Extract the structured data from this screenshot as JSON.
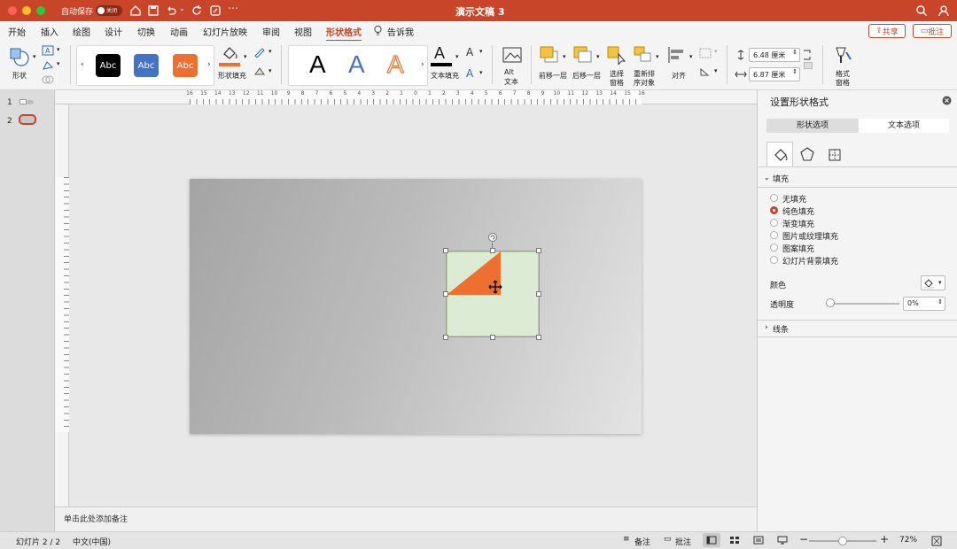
{
  "titlebar": {
    "autosave_label": "自动保存",
    "autosave_state": "关闭",
    "title": "演示文稿 3"
  },
  "menu": [
    "开始",
    "插入",
    "绘图",
    "设计",
    "切换",
    "动画",
    "幻灯片放映",
    "审阅",
    "视图",
    "形状格式",
    "告诉我"
  ],
  "share": "共享",
  "comments": "批注",
  "ribbon": {
    "shape": "形状",
    "abc": "Abc",
    "shape_fill": "形状填充",
    "text_fill": "文本填充",
    "alt_text": "Alt\n文本",
    "alt1": "Alt",
    "alt2": "文本",
    "forward": "前移一层",
    "backward": "后移一层",
    "select_pane1": "选择",
    "select_pane2": "窗格",
    "reorder1": "重新排",
    "reorder2": "序对象",
    "align": "对齐",
    "height": "6.48 厘米",
    "width": "6.87 厘米",
    "format_painter1": "格式",
    "format_painter2": "窗格",
    "bigA": "A"
  },
  "thumbs": [
    "1",
    "2"
  ],
  "ruler": [
    "16",
    "15",
    "14",
    "13",
    "12",
    "11",
    "10",
    "9",
    "8",
    "7",
    "6",
    "5",
    "4",
    "3",
    "2",
    "1",
    "0",
    "1",
    "2",
    "3",
    "4",
    "5",
    "6",
    "7",
    "8",
    "9",
    "10",
    "11",
    "12",
    "13",
    "14",
    "15",
    "16"
  ],
  "notes_placeholder": "单击此处添加备注",
  "panel": {
    "title": "设置形状格式",
    "tab_shape": "形状选项",
    "tab_text": "文本选项",
    "fill_section": "填充",
    "fill_options": [
      "无填充",
      "纯色填充",
      "渐变填充",
      "图片或纹理填充",
      "图案填充",
      "幻灯片背景填充"
    ],
    "selected_fill": 1,
    "color_label": "颜色",
    "transparency_label": "透明度",
    "transparency_value": "0%",
    "line_section": "线条"
  },
  "status": {
    "slide": "幻灯片 2 / 2",
    "language": "中文(中国)",
    "notes": "备注",
    "comments": "批注",
    "zoom": "72%",
    "zoom_level": 0.5
  },
  "colors": {
    "accent": "#c8452a",
    "orange": "#ed7030",
    "green": "#dcebd3",
    "blue": "#4472c4"
  }
}
